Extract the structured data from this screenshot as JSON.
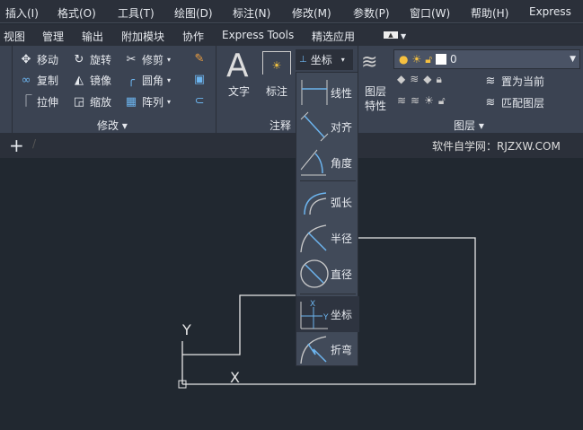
{
  "menubar": [
    "插入(I)",
    "格式(O)",
    "工具(T)",
    "绘图(D)",
    "标注(N)",
    "修改(M)",
    "参数(P)",
    "窗口(W)",
    "帮助(H)",
    "Express"
  ],
  "tabs": [
    "视图",
    "管理",
    "输出",
    "附加模块",
    "协作",
    "Express Tools",
    "精选应用"
  ],
  "modify": {
    "items": [
      "移动",
      "旋转",
      "修剪",
      "复制",
      "镜像",
      "圆角",
      "拉伸",
      "缩放",
      "阵列"
    ],
    "title": "修改"
  },
  "annotation": {
    "text": "文字",
    "dim": "标注",
    "title": "注释",
    "dim_dropdown": "坐标"
  },
  "layers": {
    "props": [
      "图层",
      "特性"
    ],
    "current_layer": "0",
    "set_current": "置为当前",
    "match": "匹配图层",
    "title": "图层"
  },
  "dim_menu": [
    "线性",
    "对齐",
    "角度",
    "弧长",
    "半径",
    "直径",
    "坐标",
    "折弯"
  ],
  "filebar": {
    "add": "+",
    "watermark": "软件自学网：RJZXW.COM"
  },
  "drawing": {
    "y_label": "Y",
    "x_label": "X"
  }
}
